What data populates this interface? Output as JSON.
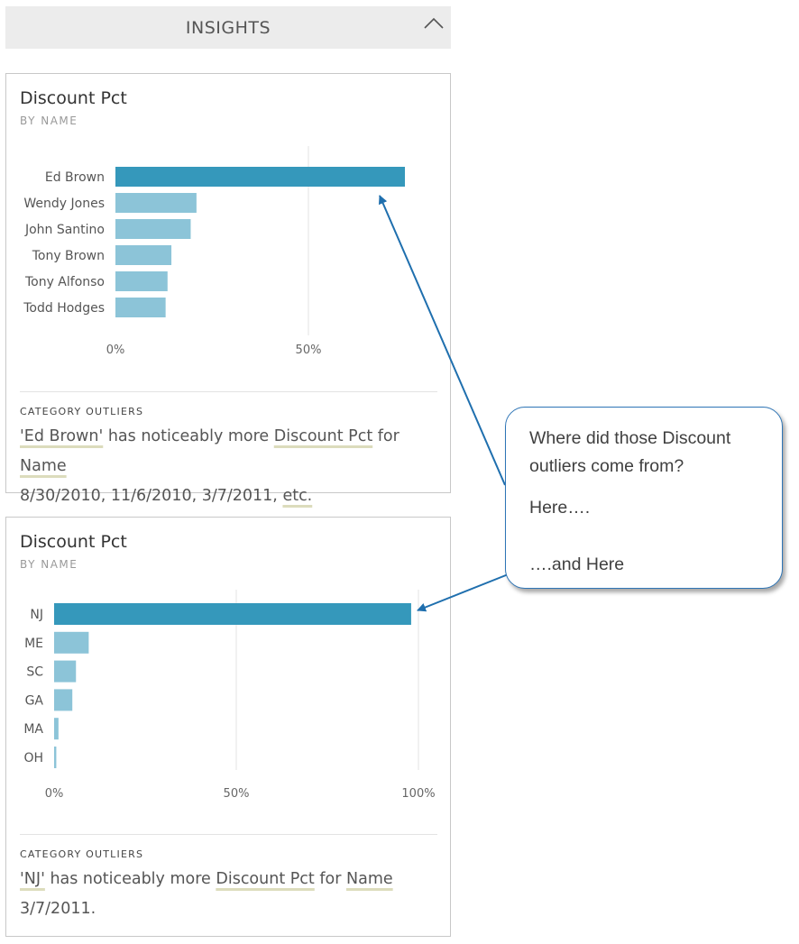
{
  "header": {
    "title": "INSIGHTS"
  },
  "cards": [
    {
      "title": "Discount Pct",
      "subtitle": "BY NAME",
      "outliers_label": "CATEGORY OUTLIERS",
      "outlier": {
        "category": "'Ed Brown'",
        "text_mid": " has noticeably more ",
        "measure": "Discount Pct",
        "text_for": " for ",
        "field": "Name",
        "dates": "8/30/2010, 11/6/2010, 3/7/2011, ",
        "more": "etc."
      }
    },
    {
      "title": "Discount Pct",
      "subtitle": "BY NAME",
      "outliers_label": "CATEGORY OUTLIERS",
      "outlier": {
        "category": "'NJ'",
        "text_mid": " has noticeably more ",
        "measure": "Discount Pct",
        "text_for": " for ",
        "field": "Name",
        "dates": "3/7/2011."
      }
    }
  ],
  "chart_data": [
    {
      "type": "bar",
      "orientation": "horizontal",
      "categories": [
        "Ed Brown",
        "Wendy Jones",
        "John Santino",
        "Tony Brown",
        "Tony Alfonso",
        "Todd Hodges"
      ],
      "values": [
        75,
        21,
        19.5,
        14.5,
        13.5,
        13
      ],
      "highlight_index": 0,
      "xlim": [
        0,
        75
      ],
      "ticks": [
        0,
        50
      ],
      "tick_labels": [
        "0%",
        "50%"
      ],
      "colors": {
        "highlight": "#3598bb",
        "normal": "#8cc4d8",
        "grid": "#e3e3e3"
      }
    },
    {
      "type": "bar",
      "orientation": "horizontal",
      "categories": [
        "NJ",
        "ME",
        "SC",
        "GA",
        "MA",
        "OH"
      ],
      "values": [
        98,
        9.5,
        6,
        5,
        1.2,
        0.6
      ],
      "highlight_index": 0,
      "xlim": [
        0,
        100
      ],
      "ticks": [
        0,
        50,
        100
      ],
      "tick_labels": [
        "0%",
        "50%",
        "100%"
      ],
      "colors": {
        "highlight": "#3598bb",
        "normal": "#8cc4d8",
        "grid": "#e3e3e3"
      }
    }
  ],
  "callout": {
    "question": "Where did those Discount outliers come from?",
    "here": "Here….",
    "and_here": "….and Here",
    "border_color": "#2e75b6"
  }
}
